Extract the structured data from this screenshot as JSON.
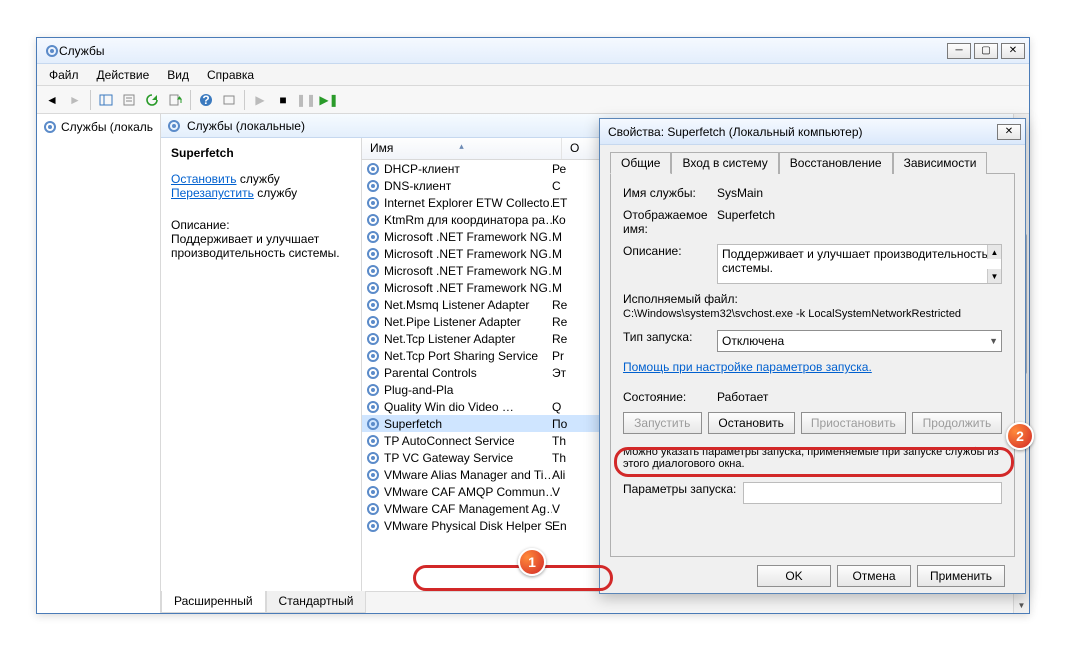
{
  "main": {
    "title": "Службы",
    "menu": [
      "Файл",
      "Действие",
      "Вид",
      "Справка"
    ],
    "tree_item": "Службы (локаль",
    "right_header": "Службы (локальные)",
    "detail": {
      "name": "Superfetch",
      "stop_link": "Остановить",
      "stop_suffix": " службу",
      "restart_link": "Перезапустить",
      "restart_suffix": " службу",
      "desc_label": "Описание:",
      "desc_text": "Поддерживает и улучшает производительность системы."
    },
    "columns": {
      "name": "Имя",
      "desc": "О"
    },
    "services": [
      {
        "n": "DHCP-клиент",
        "d": "Ре"
      },
      {
        "n": "DNS-клиент",
        "d": "С"
      },
      {
        "n": "Internet Explorer ETW Collecto…",
        "d": "ET"
      },
      {
        "n": "KtmRm для координатора ра…",
        "d": "Ко"
      },
      {
        "n": "Microsoft .NET Framework NG…",
        "d": "M"
      },
      {
        "n": "Microsoft .NET Framework NG…",
        "d": "M"
      },
      {
        "n": "Microsoft .NET Framework NG…",
        "d": "M"
      },
      {
        "n": "Microsoft .NET Framework NG…",
        "d": "M"
      },
      {
        "n": "Net.Msmq Listener Adapter",
        "d": "Re"
      },
      {
        "n": "Net.Pipe Listener Adapter",
        "d": "Re"
      },
      {
        "n": "Net.Tcp Listener Adapter",
        "d": "Re"
      },
      {
        "n": "Net.Tcp Port Sharing Service",
        "d": "Pr"
      },
      {
        "n": "Parental Controls",
        "d": "Эт"
      },
      {
        "n": "Plug-and-Pla",
        "d": ""
      },
      {
        "n": "Quality Win                    dio Video …",
        "d": "Q"
      },
      {
        "n": "Superfetch",
        "d": "По",
        "sel": true
      },
      {
        "n": "TP AutoConnect Service",
        "d": "Th"
      },
      {
        "n": "TP VC Gateway Service",
        "d": "Th"
      },
      {
        "n": "VMware Alias Manager and Ti…",
        "d": "Ali"
      },
      {
        "n": "VMware CAF AMQP Commun…",
        "d": "V"
      },
      {
        "n": "VMware CAF Management Ag…",
        "d": "V"
      },
      {
        "n": "VMware Physical Disk Helper S…",
        "d": "En"
      }
    ],
    "bottom_tabs": {
      "ext": "Расширенный",
      "std": "Стандартный"
    }
  },
  "dialog": {
    "title": "Свойства: Superfetch (Локальный компьютер)",
    "tabs": [
      "Общие",
      "Вход в систему",
      "Восстановление",
      "Зависимости"
    ],
    "labels": {
      "service_name": "Имя службы:",
      "display_name": "Отображаемое имя:",
      "description": "Описание:",
      "exe": "Исполняемый файл:",
      "startup": "Тип запуска:",
      "help_link": "Помощь при настройке параметров запуска.",
      "state": "Состояние:",
      "params": "Параметры запуска:",
      "hint": "Можно указать параметры запуска, применяемые при запуске службы из этого диалогового окна."
    },
    "values": {
      "service_name": "SysMain",
      "display_name": "Superfetch",
      "description": "Поддерживает и улучшает производительность системы.",
      "exe": "C:\\Windows\\system32\\svchost.exe -k LocalSystemNetworkRestricted",
      "startup": "Отключена",
      "state": "Работает"
    },
    "btns": {
      "start": "Запустить",
      "stop": "Остановить",
      "pause": "Приостановить",
      "resume": "Продолжить",
      "ok": "OK",
      "cancel": "Отмена",
      "apply": "Применить"
    }
  },
  "badges": {
    "b1": "1",
    "b2": "2"
  }
}
